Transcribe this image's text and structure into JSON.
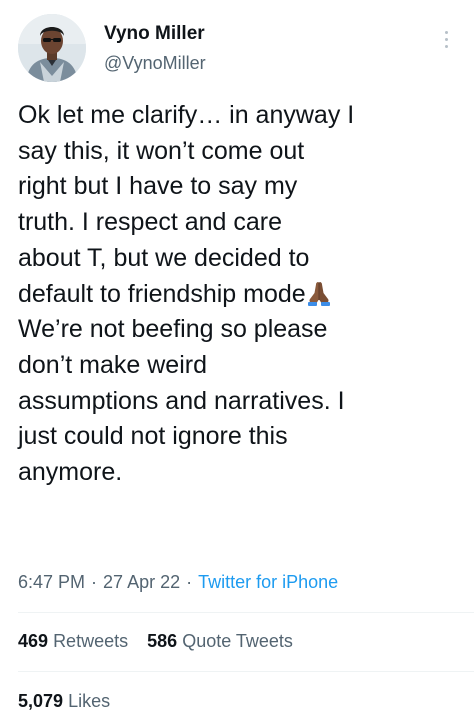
{
  "tweet": {
    "author": {
      "display_name": "Vyno Miller",
      "handle": "@VynoMiller"
    },
    "body_lines": [
      "Ok let me clarify… in anyway I",
      "say this, it won’t come out",
      "right but I have to say my",
      "truth. I respect and care",
      "about T, but we decided to",
      "default to friendship mode",
      "We’re not beefing so please",
      "don’t make weird",
      "assumptions and narratives. I",
      "just could not ignore this",
      "anymore."
    ],
    "emoji": "folded-hands-medium-dark-skin-tone",
    "time": "6:47 PM",
    "separator": "·",
    "date": "27 Apr 22",
    "source": "Twitter for iPhone",
    "retweets": {
      "count": "469",
      "label": "Retweets"
    },
    "quote_tweets": {
      "count": "586",
      "label": "Quote Tweets"
    },
    "likes": {
      "count": "5,079",
      "label": "Likes"
    }
  },
  "colors": {
    "text_primary": "#0f1419",
    "text_secondary": "#536471",
    "link": "#1d9bf0",
    "divider": "#eff3f4"
  }
}
